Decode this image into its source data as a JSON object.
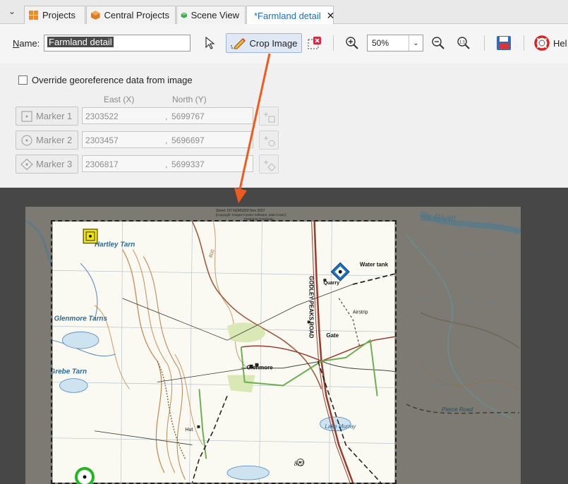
{
  "tabs": [
    {
      "label": "Projects",
      "icon": "projects-icon",
      "active": false
    },
    {
      "label": "Central Projects",
      "icon": "central-projects-icon",
      "active": false
    },
    {
      "label": "Scene View",
      "icon": "scene-view-icon",
      "active": false
    },
    {
      "label": "*Farmland detail",
      "icon": "image-icon",
      "active": true
    }
  ],
  "toolbar": {
    "name_label": "Name:",
    "name_value": "Farmland detail",
    "crop_label": "Crop Image",
    "zoom_value": "50%",
    "help_label": "Hel"
  },
  "georeference": {
    "override_label": "Override georeference data from image",
    "override_checked": false,
    "east_header": "East (X)",
    "north_header": "North (Y)",
    "markers": [
      {
        "label": "Marker 1",
        "east": "2303522",
        "north": "5699767",
        "shape": "square"
      },
      {
        "label": "Marker 2",
        "east": "2303457",
        "north": "5696697",
        "shape": "circle"
      },
      {
        "label": "Marker 3",
        "east": "2306817",
        "north": "5699337",
        "shape": "diamond"
      }
    ]
  },
  "map": {
    "header_line1": "Sheet: I37 NZMS260  Nov 2007",
    "header_line2": "[Copyright: Images Forster Software, data Crown]",
    "header_line3": "Printed by Freshmap",
    "labels": {
      "hartley": "Hartley Tarn",
      "water_tank": "Water tank",
      "quarry": "Quarry",
      "airstrip": "Airstrip",
      "road": "GODLEY PEAKS ROAD",
      "gate": "Gate",
      "glenmore_tarns": "Glenmore Tarns",
      "glenmore": "Glenmore",
      "grebe": "Grebe Tarn",
      "hut": "Hut",
      "lake_murray": "Lake Murray",
      "spot_height": "812",
      "pierce": "Pierce Road",
      "river": "as River",
      "contour": "800"
    }
  },
  "colors": {
    "accent": "#1a6fc9",
    "arrow": "#f05a1e",
    "marker1": "#f5e400",
    "marker2": "#1fb81f",
    "marker3": "#1b73c7"
  }
}
